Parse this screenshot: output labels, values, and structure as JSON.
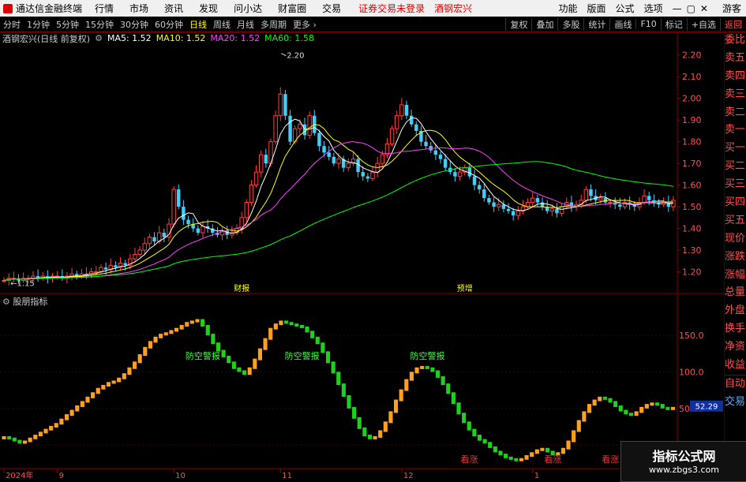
{
  "menubar": {
    "app_name": "通达信金融终端",
    "menus": [
      "行情",
      "市场",
      "资讯",
      "发现",
      "问小达",
      "财富圈",
      "交易"
    ],
    "notice": "证券交易未登录",
    "stock": "酒钢宏兴",
    "right": [
      "功能",
      "版面",
      "公式",
      "选项",
      "游客"
    ]
  },
  "toolbar": {
    "periods": [
      "分时",
      "1分钟",
      "5分钟",
      "15分钟",
      "30分钟",
      "60分钟",
      "日线",
      "周线",
      "月线",
      "多周期",
      "更多"
    ],
    "active": "日线",
    "right": [
      "复权",
      "叠加",
      "多股",
      "统计",
      "画线",
      "F10",
      "标记",
      "+自选",
      "返回"
    ]
  },
  "infobar": {
    "title": "酒钢宏兴(日线 前复权)",
    "ma": [
      {
        "label": "MA5: 1.52",
        "color": "#ffffff"
      },
      {
        "label": "MA10: 1.52",
        "color": "#ffff00"
      },
      {
        "label": "MA20: 1.52",
        "color": "#ff40ff"
      },
      {
        "label": "MA60: 1.58",
        "color": "#00ff00"
      }
    ]
  },
  "side_panel": [
    "委比",
    "卖五",
    "卖四",
    "卖三",
    "卖二",
    "卖一",
    "买一",
    "买二",
    "买三",
    "买四",
    "买五",
    "现价",
    "涨跌",
    "涨幅",
    "总量",
    "外盘",
    "换手",
    "净资",
    "收益",
    "自动",
    "交易"
  ],
  "indicator": {
    "name": "股朋指标",
    "current": "52.29"
  },
  "watermark": {
    "title": "指标公式网",
    "url": "www.zbgs3.com"
  },
  "chart_data": [
    {
      "type": "candlestick",
      "ylim": [
        1.1,
        2.25
      ],
      "y_ticks": [
        "2.20",
        "2.10",
        "2.00",
        "1.90",
        "1.80",
        "1.70",
        "1.60",
        "1.50",
        "1.40",
        "1.30",
        "1.20"
      ],
      "y_tick_values": [
        2.2,
        2.1,
        2.0,
        1.9,
        1.8,
        1.7,
        1.6,
        1.5,
        1.4,
        1.3,
        1.2
      ],
      "annotations": [
        {
          "text": "2.20",
          "x": "high",
          "y": 2.2
        },
        {
          "text": "1.15",
          "x": "low",
          "y": 1.15
        },
        {
          "text": "财报",
          "x": "event1"
        },
        {
          "text": "预增",
          "x": "event2"
        }
      ],
      "x_labels": [
        {
          "text": "2024年",
          "idx": 0
        },
        {
          "text": "9",
          "idx": 11
        },
        {
          "text": "10",
          "idx": 35
        },
        {
          "text": "11",
          "idx": 57
        },
        {
          "text": "12",
          "idx": 82
        },
        {
          "text": "1",
          "idx": 109
        },
        {
          "text": "2",
          "idx": 131
        }
      ],
      "closes": [
        1.16,
        1.17,
        1.17,
        1.16,
        1.17,
        1.17,
        1.18,
        1.17,
        1.18,
        1.17,
        1.18,
        1.18,
        1.17,
        1.18,
        1.19,
        1.18,
        1.19,
        1.19,
        1.2,
        1.2,
        1.22,
        1.21,
        1.23,
        1.22,
        1.24,
        1.23,
        1.26,
        1.28,
        1.3,
        1.33,
        1.36,
        1.34,
        1.38,
        1.36,
        1.42,
        1.58,
        1.5,
        1.44,
        1.42,
        1.4,
        1.38,
        1.41,
        1.4,
        1.38,
        1.37,
        1.39,
        1.37,
        1.38,
        1.4,
        1.45,
        1.52,
        1.6,
        1.66,
        1.74,
        1.7,
        1.8,
        1.92,
        2.02,
        1.92,
        1.8,
        1.86,
        1.88,
        1.83,
        1.92,
        1.84,
        1.78,
        1.75,
        1.73,
        1.7,
        1.72,
        1.68,
        1.7,
        1.72,
        1.66,
        1.64,
        1.63,
        1.66,
        1.7,
        1.74,
        1.79,
        1.86,
        1.92,
        1.97,
        1.92,
        1.88,
        1.85,
        1.8,
        1.78,
        1.76,
        1.74,
        1.72,
        1.68,
        1.66,
        1.64,
        1.66,
        1.68,
        1.64,
        1.6,
        1.58,
        1.54,
        1.52,
        1.5,
        1.51,
        1.49,
        1.48,
        1.46,
        1.48,
        1.5,
        1.52,
        1.54,
        1.52,
        1.5,
        1.48,
        1.49,
        1.47,
        1.5,
        1.52,
        1.5,
        1.51,
        1.53,
        1.58,
        1.55,
        1.53,
        1.54,
        1.52,
        1.52,
        1.51,
        1.5,
        1.52,
        1.51,
        1.5,
        1.52,
        1.55,
        1.53,
        1.52,
        1.51,
        1.52,
        1.5,
        1.53
      ],
      "series": [
        {
          "name": "MA5",
          "color": "#ffffff"
        },
        {
          "name": "MA10",
          "color": "#ffff00"
        },
        {
          "name": "MA20",
          "color": "#ff40ff"
        },
        {
          "name": "MA60",
          "color": "#00ff00"
        }
      ]
    },
    {
      "type": "bar",
      "ylim": [
        -30,
        190
      ],
      "y_ticks": [
        "150.0",
        "100.0",
        "50.00",
        "0.00"
      ],
      "y_tick_values": [
        150,
        100,
        50,
        0
      ],
      "values": [
        10,
        8,
        5,
        2,
        4,
        8,
        12,
        16,
        20,
        24,
        28,
        34,
        40,
        46,
        52,
        58,
        64,
        70,
        76,
        80,
        84,
        86,
        90,
        96,
        104,
        112,
        122,
        132,
        140,
        146,
        150,
        152,
        155,
        158,
        162,
        166,
        168,
        170,
        162,
        150,
        138,
        128,
        120,
        112,
        104,
        100,
        96,
        104,
        116,
        130,
        144,
        158,
        164,
        168,
        166,
        164,
        162,
        160,
        154,
        146,
        138,
        126,
        112,
        98,
        82,
        66,
        50,
        36,
        22,
        12,
        8,
        10,
        18,
        30,
        44,
        60,
        74,
        88,
        98,
        104,
        106,
        104,
        100,
        92,
        82,
        70,
        56,
        42,
        30,
        20,
        12,
        6,
        2,
        -4,
        -10,
        -14,
        -18,
        -20,
        -22,
        -20,
        -16,
        -12,
        -8,
        -6,
        -10,
        -14,
        -12,
        -6,
        4,
        18,
        32,
        44,
        54,
        60,
        64,
        62,
        58,
        52,
        46,
        42,
        40,
        44,
        50,
        54,
        56,
        54,
        50,
        48,
        50
      ],
      "labels": [
        {
          "text": "防空警报",
          "idx": 38,
          "y": 118
        },
        {
          "text": "防空警报",
          "idx": 57,
          "y": 118
        },
        {
          "text": "防空警报",
          "idx": 81,
          "y": 118
        },
        {
          "text": "看涨",
          "idx": 89,
          "y": -58
        },
        {
          "text": "看涨",
          "idx": 105,
          "y": -58
        },
        {
          "text": "看涨",
          "idx": 116,
          "y": -58
        }
      ]
    }
  ]
}
